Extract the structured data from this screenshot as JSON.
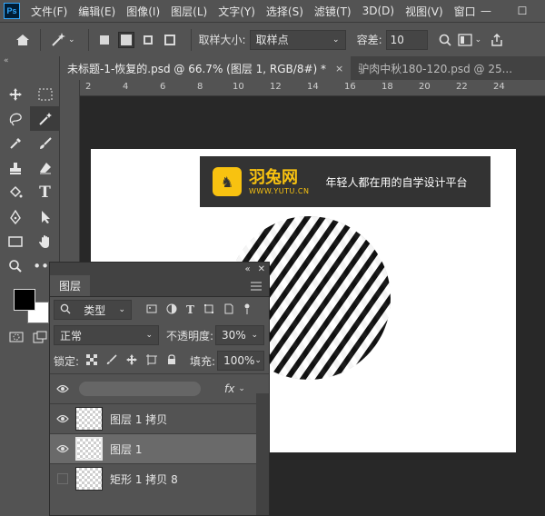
{
  "app": {
    "logo": "Ps"
  },
  "menu": [
    "文件(F)",
    "编辑(E)",
    "图像(I)",
    "图层(L)",
    "文字(Y)",
    "选择(S)",
    "滤镜(T)",
    "3D(D)",
    "视图(V)",
    "窗口"
  ],
  "window_controls": {
    "minimize": "—",
    "maximize": "☐"
  },
  "options": {
    "sample_size_label": "取样大小:",
    "sample_size_value": "取样点",
    "tolerance_label": "容差:",
    "tolerance_value": "10"
  },
  "tabs": [
    {
      "label": "未标题-1-恢复的.psd @ 66.7% (图层 1, RGB/8#) *",
      "close": "×"
    },
    {
      "label": "驴肉中秋180-120.psd @ 25..."
    }
  ],
  "ruler": {
    "ticks": [
      "2",
      "4",
      "6",
      "8",
      "10",
      "12",
      "14",
      "16",
      "18",
      "20",
      "22",
      "24"
    ]
  },
  "banner": {
    "brand": "羽兔网",
    "url": "WWW.YUTU.CN",
    "slogan": "年轻人都在用的自学设计平台",
    "logo_glyph": "♞"
  },
  "layers_panel": {
    "tab": "图层",
    "filter_kind": "类型",
    "blend_mode": "正常",
    "opacity_label": "不透明度:",
    "opacity_value": "30%",
    "lock_label": "锁定:",
    "fill_label": "填充:",
    "fill_value": "100%",
    "fx_label": "fx",
    "layers": [
      {
        "name": "图层 1 拷贝",
        "visible": true,
        "selected": false
      },
      {
        "name": "图层 1",
        "visible": true,
        "selected": true
      },
      {
        "name": "矩形 1 拷贝 8",
        "visible": false,
        "selected": false
      }
    ]
  },
  "colors": {
    "accent_yellow": "#f8c210",
    "panel_bg": "#535353",
    "dark_bg": "#282828"
  }
}
